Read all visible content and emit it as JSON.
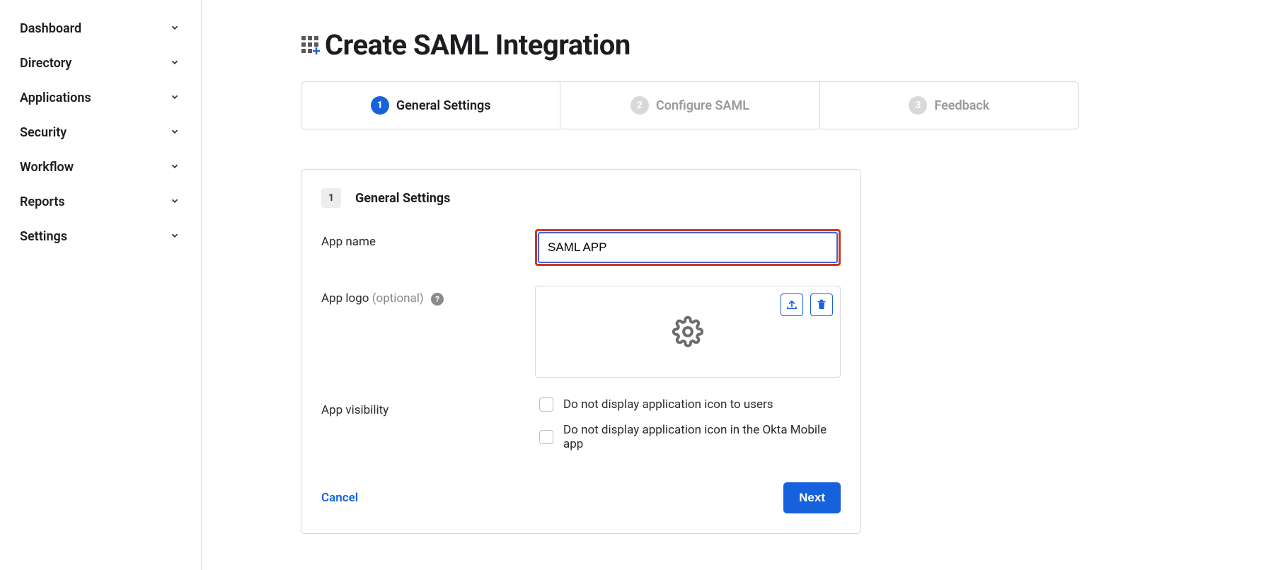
{
  "sidebar": {
    "items": [
      {
        "label": "Dashboard"
      },
      {
        "label": "Directory"
      },
      {
        "label": "Applications"
      },
      {
        "label": "Security"
      },
      {
        "label": "Workflow"
      },
      {
        "label": "Reports"
      },
      {
        "label": "Settings"
      }
    ]
  },
  "page": {
    "title": "Create SAML Integration"
  },
  "stepper": [
    {
      "num": "1",
      "label": "General Settings",
      "active": true
    },
    {
      "num": "2",
      "label": "Configure SAML",
      "active": false
    },
    {
      "num": "3",
      "label": "Feedback",
      "active": false
    }
  ],
  "form": {
    "section_num": "1",
    "section_title": "General Settings",
    "app_name_label": "App name",
    "app_name_value": "SAML APP",
    "app_logo_label": "App logo ",
    "app_logo_optional": "(optional)",
    "app_visibility_label": "App visibility",
    "checkbox1": "Do not display application icon to users",
    "checkbox2": "Do not display application icon in the Okta Mobile app",
    "cancel": "Cancel",
    "next": "Next"
  }
}
